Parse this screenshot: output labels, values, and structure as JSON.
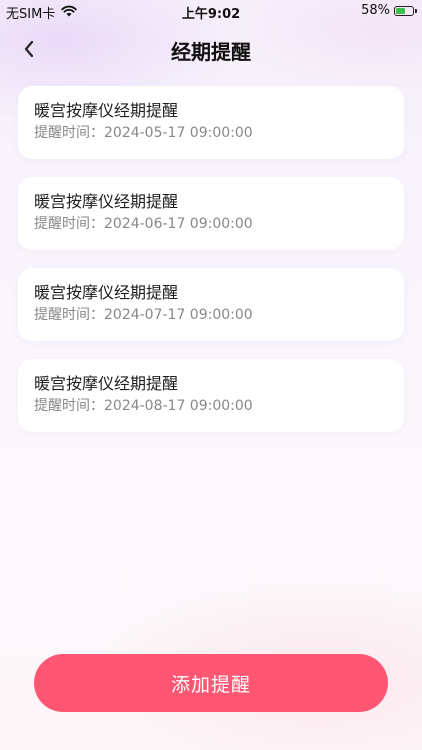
{
  "status_bar": {
    "carrier": "无SIM卡",
    "time": "上午9:02",
    "battery": "58%",
    "battery_level": 0.58
  },
  "nav": {
    "title": "经期提醒"
  },
  "reminders": [
    {
      "title": "暖宫按摩仪经期提醒",
      "time_label": "提醒时间：",
      "time": "2024-05-17 09:00:00"
    },
    {
      "title": "暖宫按摩仪经期提醒",
      "time_label": "提醒时间：",
      "time": "2024-06-17 09:00:00"
    },
    {
      "title": "暖宫按摩仪经期提醒",
      "time_label": "提醒时间：",
      "time": "2024-07-17 09:00:00"
    },
    {
      "title": "暖宫按摩仪经期提醒",
      "time_label": "提醒时间：",
      "time": "2024-08-17 09:00:00"
    }
  ],
  "add_button": {
    "label": "添加提醒"
  },
  "colors": {
    "accent": "#ff5673",
    "battery_charge": "#3bc24a"
  }
}
